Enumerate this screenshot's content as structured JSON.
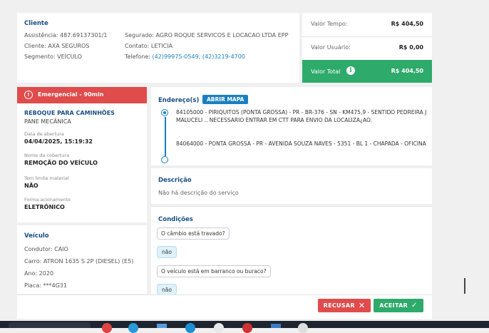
{
  "cliente": {
    "title": "Cliente",
    "assistencia": "Assistência: 487.69137301/1",
    "cliente": "Cliente: AXA SEGUROS",
    "segmento": "Segmento: VEÍCULO",
    "segurado": "Segurado: AGRO ROQUE SERVICOS E LOCACAO LTDA EPP",
    "contato": "Contato: LETICIA",
    "telefone_label": "Telefone: ",
    "telefone_value": "(42)99975-0549; (42)3219-4700"
  },
  "valores": {
    "tempo_label": "Valor Tempo:",
    "tempo_value": "R$ 404,50",
    "usuario_label": "Valor Usuário:",
    "usuario_value": "R$ 0,00",
    "total_label": "Valor Total",
    "total_value": "R$ 404,50"
  },
  "servico": {
    "emergencia": "Emergencial - 90min",
    "tipo": "REBOQUE PARA CAMINHÕES",
    "subtipo": "PANE MECÂNICA",
    "abertura_label": "Data de abertura",
    "abertura_value": "04/04/2025, 15:19:32",
    "cobertura_label": "Nome da cobertura",
    "cobertura_value": "REMOÇÃO DO VEÍCULO",
    "limite_label": "Tem limite material",
    "limite_value": "NÃO",
    "forma_label": "Forma acionamento",
    "forma_value": "ELETRÔNICO"
  },
  "veiculo": {
    "title": "Veículo",
    "condutor": "Condutor: CAIO",
    "carro": "Carro: ATRON 1635 S 2P (DIESEL) (E5)",
    "ano": "Ano: 2020",
    "placa": "Placa: ***4G31"
  },
  "endereco": {
    "title": "Endereço(s)",
    "mapa_button": "ABRIR MAPA",
    "origem": "84105000 - PIRIQUITOS (PONTA GROSSA) - PR - BR-376 - SN - KM475,9 - SENTIDO PEDREIRA J MALUCELI .. NECESSARIO ENTRAR EM CTT PARA ENVIO DA LOCALIZA¿AO.",
    "destino": "84064000 - PONTA GROSSA - PR - AVENIDA SOUZA NAVES - 5351 - BL 1 - CHAPADA - OFICINA"
  },
  "descricao": {
    "title": "Descrição",
    "text": "Não há descrição do serviço"
  },
  "condicoes": {
    "title": "Condições",
    "q1": "O câmbio está travado?",
    "a1": "não",
    "q2": "O veículo está em barranco ou buraco?",
    "a2": "não"
  },
  "actions": {
    "recusar": "RECUSAR",
    "aceitar": "ACEITAR"
  },
  "colors": {
    "green": "#2eaa6b",
    "red": "#e04b4b",
    "blue": "#1b4f83",
    "link": "#1a7fc1"
  }
}
